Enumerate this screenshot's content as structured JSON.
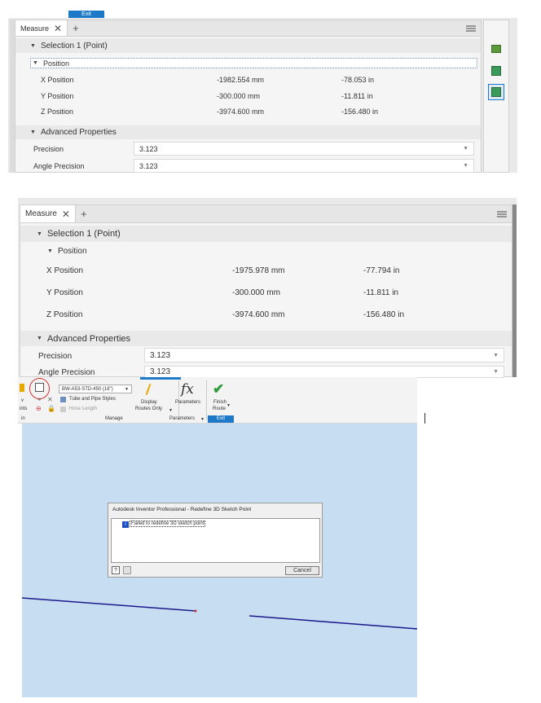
{
  "top": {
    "exit_tab": "Exit",
    "tab_label": "Measure",
    "selection": "Selection 1 (Point)",
    "position": "Position",
    "rows": [
      {
        "label": "X Position",
        "mm": "-1982.554 mm",
        "in": "-78.053 in"
      },
      {
        "label": "Y Position",
        "mm": "-300.000 mm",
        "in": "-11.811 in"
      },
      {
        "label": "Z Position",
        "mm": "-3974.600 mm",
        "in": "-156.480 in"
      }
    ],
    "advanced": "Advanced Properties",
    "precision_label": "Precision",
    "precision_value": "3.123",
    "angle_label": "Angle Precision",
    "angle_value": "3.123"
  },
  "mid": {
    "tab_label": "Measure",
    "selection": "Selection 1 (Point)",
    "position": "Position",
    "rows": [
      {
        "label": "X Position",
        "mm": "-1975.978 mm",
        "in": "-77.794 in"
      },
      {
        "label": "Y Position",
        "mm": "-300.000 mm",
        "in": "-11.811 in"
      },
      {
        "label": "Z Position",
        "mm": "-3974.600 mm",
        "in": "-156.480 in"
      }
    ],
    "advanced": "Advanced Properties",
    "precision_label": "Precision",
    "precision_value": "3.123",
    "angle_label": "Angle Precision",
    "angle_value": "3.123"
  },
  "ribbon": {
    "style_select": "BW-A53-STD-450 (18\")",
    "tube_pipe": "Tube and Pipe Styles",
    "hose_length": "Hose Length",
    "manage": "Manage",
    "display_routes": "Display",
    "display_routes2": "Routes Only",
    "parameters": "Parameters",
    "parameters_group": "Parameters",
    "finish": "Finish",
    "finish2": "Route",
    "exit_group": "Exit",
    "left_fragment1": "v",
    "left_fragment2": "ints",
    "left_fragment3": "in",
    "fx": "fx"
  },
  "dialog": {
    "title": "Autodesk Inventor Professional - Redefine 3D Sketch Point",
    "message": "Failed to redefine 3D sketch point",
    "cancel": "Cancel"
  },
  "colors": {
    "canvas": "#c7ddf1",
    "line": "#1a1a8c",
    "accent": "#1e7ac8",
    "green": "#2e9a3c",
    "circle": "#d03030"
  }
}
